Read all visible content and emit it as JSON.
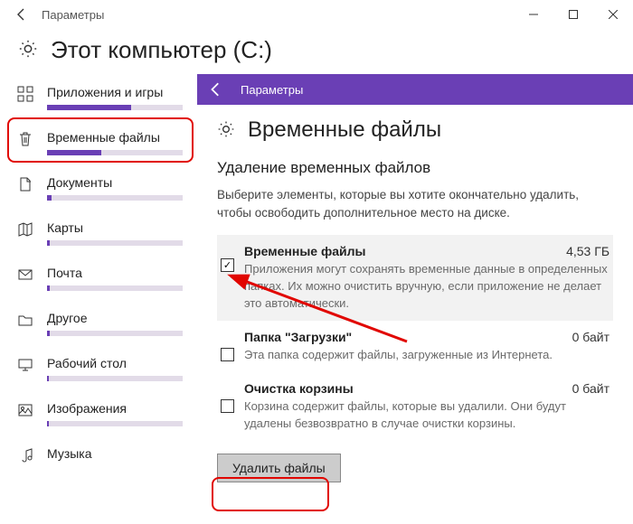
{
  "window": {
    "title": "Параметры"
  },
  "page": {
    "title": "Этот компьютер (C:)"
  },
  "sidebar": {
    "items": [
      {
        "label": "Приложения и игры",
        "fillPct": 62
      },
      {
        "label": "Временные файлы",
        "fillPct": 40
      },
      {
        "label": "Документы",
        "fillPct": 3
      },
      {
        "label": "Карты",
        "fillPct": 2
      },
      {
        "label": "Почта",
        "fillPct": 2
      },
      {
        "label": "Другое",
        "fillPct": 2
      },
      {
        "label": "Рабочий стол",
        "fillPct": 1
      },
      {
        "label": "Изображения",
        "fillPct": 1
      },
      {
        "label": "Музыка",
        "fillPct": 0
      }
    ]
  },
  "content": {
    "headerTitle": "Параметры",
    "title": "Временные файлы",
    "sectionHeading": "Удаление временных файлов",
    "sectionDesc": "Выберите элементы, которые вы хотите окончательно удалить, чтобы освободить дополнительное место на диске.",
    "items": [
      {
        "name": "Временные файлы",
        "size": "4,53 ГБ",
        "desc": "Приложения могут сохранять временные данные в определенных папках. Их можно очистить вручную, если приложение не делает это автоматически.",
        "checked": true
      },
      {
        "name": "Папка \"Загрузки\"",
        "size": "0 байт",
        "desc": "Эта папка содержит файлы, загруженные из Интернета.",
        "checked": false
      },
      {
        "name": "Очистка корзины",
        "size": "0 байт",
        "desc": "Корзина содержит файлы, которые вы удалили. Они будут удалены безвозвратно в случае очистки корзины.",
        "checked": false
      }
    ],
    "deleteBtn": "Удалить файлы"
  }
}
